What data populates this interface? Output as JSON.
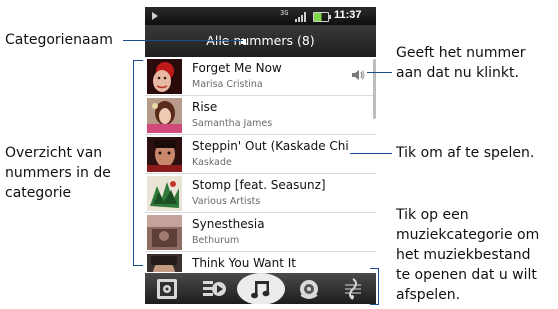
{
  "status_bar": {
    "clock": "11:37",
    "network_label": "3G",
    "icons": [
      "play-icon",
      "network-icon",
      "signal-icon",
      "battery-icon"
    ]
  },
  "header": {
    "title": "Alle nummers (8)"
  },
  "songs": [
    {
      "title": "Forget Me Now",
      "artist": "Marisa Cristina",
      "playing": true
    },
    {
      "title": "Rise",
      "artist": "Samantha James",
      "playing": false
    },
    {
      "title": "Steppin' Out (Kaskade Chi",
      "artist": "Kaskade",
      "playing": false
    },
    {
      "title": "Stomp [feat. Seasunz]",
      "artist": "Various Artists",
      "playing": false
    },
    {
      "title": "Synesthesia",
      "artist": "Bethurum",
      "playing": false
    },
    {
      "title": "Think You Want It",
      "artist": "",
      "playing": false
    }
  ],
  "tabs": [
    {
      "icon": "artist-icon",
      "selected": false
    },
    {
      "icon": "album-icon",
      "selected": false
    },
    {
      "icon": "music-note-icon",
      "selected": true
    },
    {
      "icon": "playlist-icon",
      "selected": false
    },
    {
      "icon": "genre-icon",
      "selected": false
    }
  ],
  "callouts": {
    "category_name": "Categorienaam",
    "now_playing_line1": "Geeft het nummer",
    "now_playing_line2": "aan dat nu klinkt.",
    "overview_line1": "Overzicht van",
    "overview_line2": "nummers in de",
    "overview_line3": "categorie",
    "tap_to_play": "Tik om af te spelen.",
    "tap_category_line1": "Tik op een",
    "tap_category_line2": "muziekcategorie om",
    "tap_category_line3": "het muziekbestand",
    "tap_category_line4": "te openen dat u wilt",
    "tap_category_line5": "afspelen."
  },
  "colors": {
    "callout_line": "#1a4f8f",
    "header_bg": "#2a2a2a",
    "tab_selected": "#e8e8e8"
  }
}
